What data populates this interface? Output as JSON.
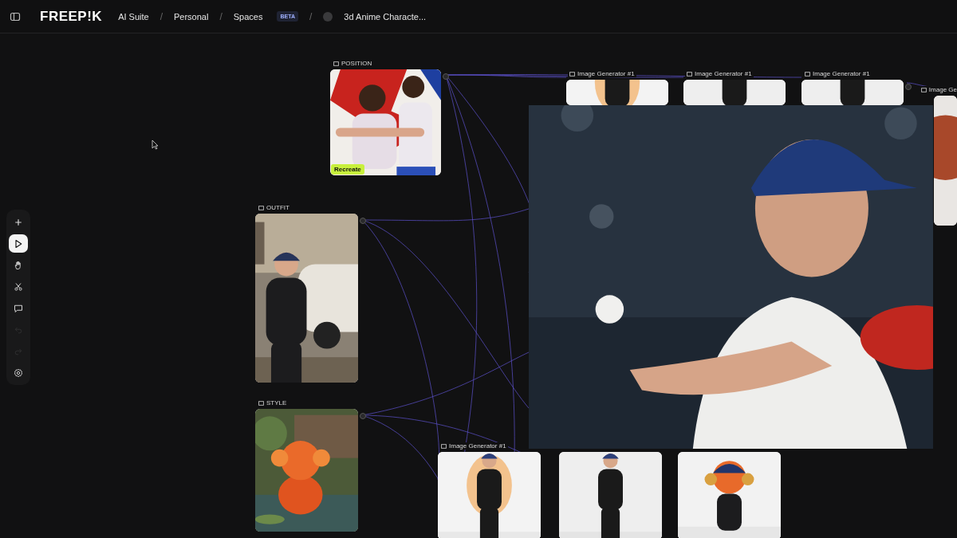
{
  "header": {
    "logo": "FREEP!K",
    "breadcrumbs": [
      {
        "label": "AI Suite"
      },
      {
        "sep": "/",
        "label": "Personal"
      },
      {
        "sep": "/",
        "label": "Spaces",
        "badge": "BETA"
      },
      {
        "sep": "/",
        "label": "3d Anime Characte...",
        "avatar": true
      }
    ]
  },
  "toolbar": [
    {
      "kind": "add",
      "selected": false,
      "disabled": false
    },
    {
      "kind": "select",
      "selected": true,
      "disabled": false
    },
    {
      "kind": "hand",
      "selected": false,
      "disabled": false
    },
    {
      "kind": "cut",
      "selected": false,
      "disabled": false
    },
    {
      "kind": "comment",
      "selected": false,
      "disabled": false
    },
    {
      "kind": "undo",
      "selected": false,
      "disabled": true
    },
    {
      "kind": "redo",
      "selected": false,
      "disabled": true
    },
    {
      "kind": "settings",
      "selected": false,
      "disabled": false
    }
  ],
  "nodes": [
    {
      "kind": "picture",
      "label": "POSITION",
      "badge": "Recreate"
    },
    {
      "kind": "picture",
      "label": "OUTFIT"
    },
    {
      "kind": "picture",
      "label": "STYLE"
    },
    {
      "kind": "picture",
      "label": "Image Generator #1"
    },
    {
      "kind": "picture",
      "label": "Image Generator #1"
    },
    {
      "kind": "picture",
      "label": "Image Generator #1"
    },
    {
      "kind": "picture",
      "label": "Image Ge"
    },
    {
      "kind": "picture",
      "label": "Image Generator #1"
    },
    {
      "kind": "picture"
    },
    {
      "kind": "picture"
    }
  ],
  "preview": {
    "kind": "picture"
  }
}
